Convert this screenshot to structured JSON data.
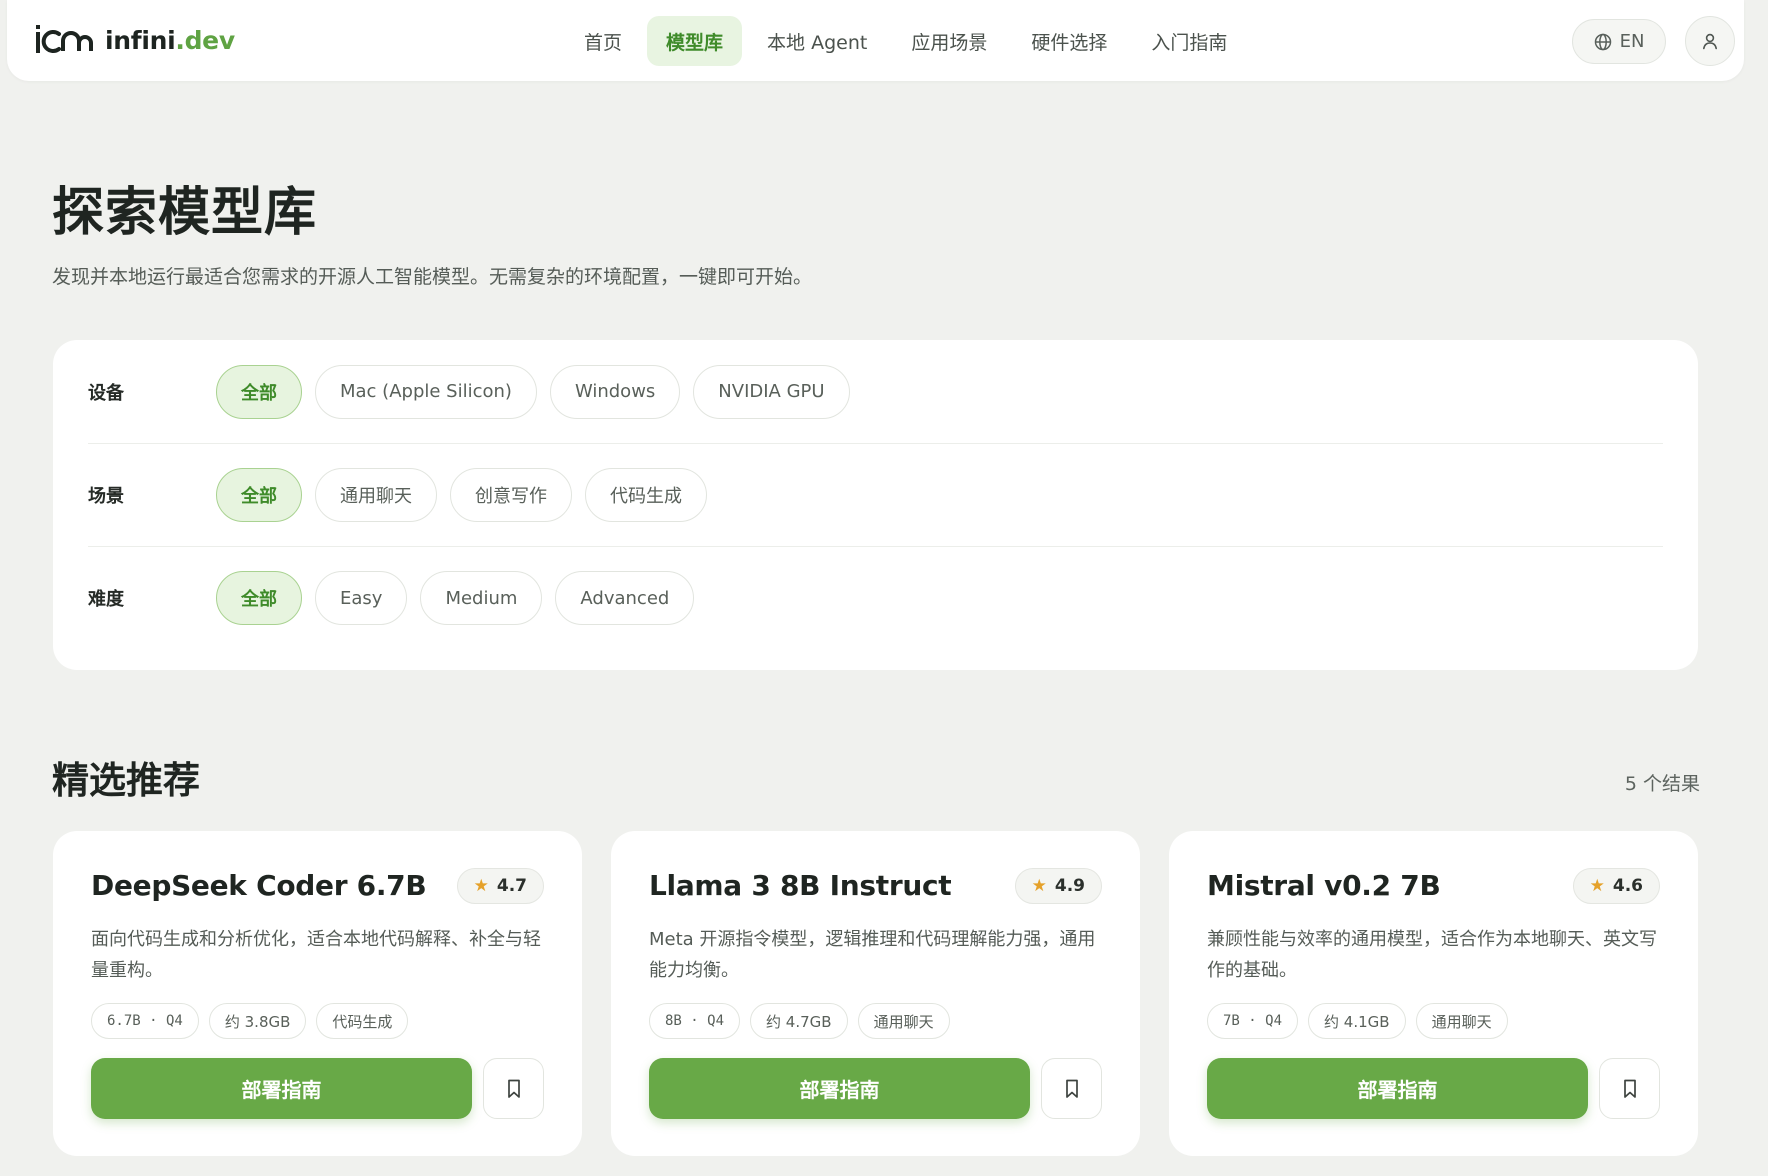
{
  "brand": {
    "name_main": "infini",
    "name_dot": ".dev"
  },
  "nav": {
    "links": [
      {
        "label": "首页"
      },
      {
        "label": "模型库"
      },
      {
        "label": "本地 Agent"
      },
      {
        "label": "应用场景"
      },
      {
        "label": "硬件选择"
      },
      {
        "label": "入门指南"
      }
    ],
    "active_index": 1,
    "language": "EN",
    "icons": {
      "language": "globe-icon",
      "user": "user-icon"
    }
  },
  "hero": {
    "title": "探索模型库",
    "subtitle": "发现并本地运行最适合您需求的开源人工智能模型。无需复杂的环境配置，一键即可开始。"
  },
  "filters": [
    {
      "label": "设备",
      "options": [
        "全部",
        "Mac (Apple Silicon)",
        "Windows",
        "NVIDIA GPU"
      ],
      "selected": "全部"
    },
    {
      "label": "场景",
      "options": [
        "全部",
        "通用聊天",
        "创意写作",
        "代码生成"
      ],
      "selected": "全部"
    },
    {
      "label": "难度",
      "options": [
        "全部",
        "Easy",
        "Medium",
        "Advanced"
      ],
      "selected": "全部"
    }
  ],
  "section": {
    "title": "精选推荐",
    "result_count": "5 个结果"
  },
  "cards": [
    {
      "name": "DeepSeek Coder 6.7B",
      "rating": "4.7",
      "description": "面向代码生成和分析优化，适合本地代码解释、补全与轻量重构。",
      "tags": [
        "6.7B · Q4",
        "约 3.8GB",
        "代码生成"
      ],
      "deploy_label": "部署指南"
    },
    {
      "name": "Llama 3 8B Instruct",
      "rating": "4.9",
      "description": "Meta 开源指令模型，逻辑推理和代码理解能力强，通用能力均衡。",
      "tags": [
        "8B · Q4",
        "约 4.7GB",
        "通用聊天"
      ],
      "deploy_label": "部署指南"
    },
    {
      "name": "Mistral v0.2 7B",
      "rating": "4.6",
      "description": "兼顾性能与效率的通用模型，适合作为本地聊天、英文写作的基础。",
      "tags": [
        "7B · Q4",
        "约 4.1GB",
        "通用聊天"
      ],
      "deploy_label": "部署指南"
    }
  ],
  "colors": {
    "accent": "#68a947",
    "accent_soft": "#e7f4df",
    "background": "#f0f1ee",
    "star": "#e5a12a"
  }
}
